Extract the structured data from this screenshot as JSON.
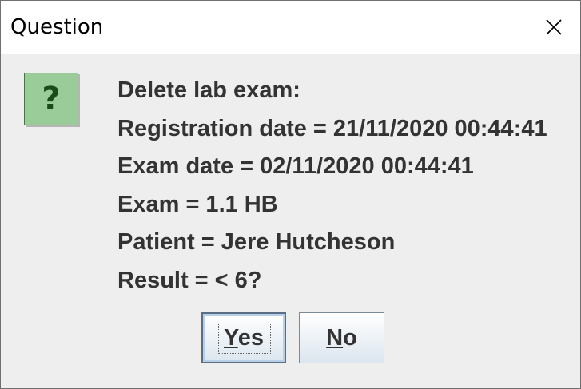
{
  "dialog": {
    "title": "Question",
    "close_icon": "close-icon",
    "question_icon": "question-icon",
    "question_glyph": "?",
    "messages": [
      "Delete lab exam:",
      "Registration date = 21/11/2020 00:44:41",
      "Exam date = 02/11/2020 00:44:41",
      "Exam = 1.1 HB",
      "Patient = Jere Hutcheson",
      "Result = < 6?"
    ],
    "buttons": {
      "yes": {
        "mnemonic": "Y",
        "rest": "es"
      },
      "no": {
        "mnemonic": "N",
        "rest": "o"
      }
    }
  },
  "colors": {
    "window_bg": "#eeeeee",
    "titlebar_bg": "#ffffff",
    "text": "#333333",
    "icon_bg": "#99cc99",
    "icon_glyph": "#184d18"
  }
}
